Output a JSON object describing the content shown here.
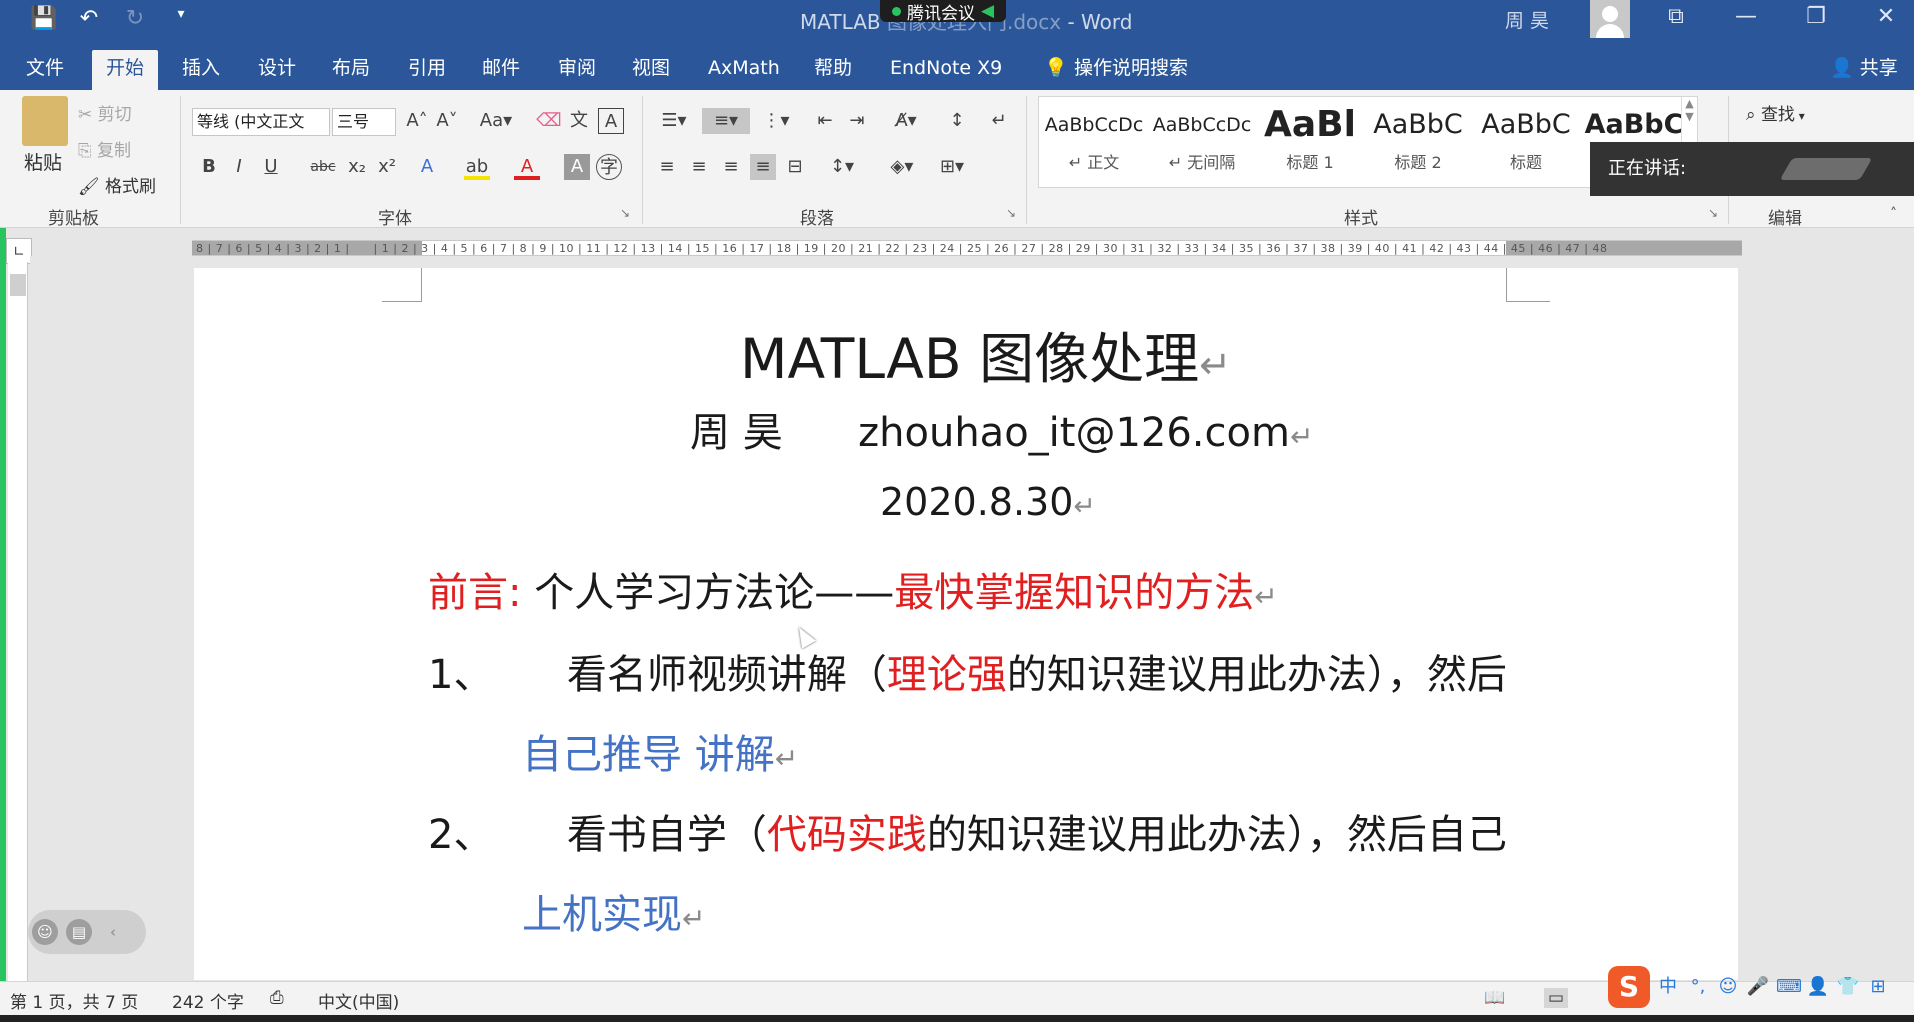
{
  "titlebar": {
    "title_prefix": "MATLAB",
    "title_file": "图像处理入门.docx",
    "title_app": "Word",
    "meeting_label": "腾讯会议",
    "user": "周 昊",
    "qat": {
      "save": "💾",
      "undo": "↶",
      "redo": "↻",
      "customize": "▾"
    },
    "win": {
      "ribbon_display": "⧉",
      "minimize": "—",
      "restore": "❐",
      "close": "✕"
    }
  },
  "tabs": [
    "文件",
    "开始",
    "插入",
    "设计",
    "布局",
    "引用",
    "邮件",
    "审阅",
    "视图",
    "AxMath",
    "帮助",
    "EndNote X9"
  ],
  "active_tab": "开始",
  "tell_me": "操作说明搜索",
  "share": "共享",
  "clipboard": {
    "paste": "粘贴",
    "cut": "剪切",
    "copy": "复制",
    "format_painter": "格式刷",
    "label": "剪贴板"
  },
  "font": {
    "name": "等线 (中文正文",
    "size": "三号",
    "label": "字体"
  },
  "paragraph": {
    "label": "段落"
  },
  "styles": {
    "label": "样式",
    "items": [
      {
        "sample": "AaBbCcDc",
        "name": "↵ 正文"
      },
      {
        "sample": "AaBbCcDc",
        "name": "↵ 无间隔"
      },
      {
        "sample": "AaBl",
        "name": "标题 1"
      },
      {
        "sample": "AaBbC",
        "name": "标题 2"
      },
      {
        "sample": "AaBbC",
        "name": "标题"
      },
      {
        "sample": "AaBbC",
        "name": ""
      }
    ]
  },
  "editing": {
    "find": "查找",
    "label": "编辑"
  },
  "speaking": {
    "label": "正在讲话:"
  },
  "document": {
    "title": "MATLAB 图像处理",
    "author": "周  昊",
    "email": "zhouhao_it@126.com",
    "date": "2020.8.30",
    "preface_label": "前言:",
    "preface_mid": "个人学习方法论——",
    "preface_red": "最快掌握知识的方法",
    "item1_num": "1、",
    "item1_a": "看名师视频讲解（",
    "item1_red": "理论强",
    "item1_b": "的知识建议用此办法），然后",
    "item1_blue": "自己推导    讲解",
    "item2_num": "2、",
    "item2_a": "看书自学（",
    "item2_red": "代码实践",
    "item2_b": "的知识建议用此办法），然后自己",
    "item2_blue": "上机实现",
    "para_mark": "↵"
  },
  "status": {
    "page": "第 1 页，共 7 页",
    "words": "242 个字",
    "lang": "中文(中国)"
  },
  "ime": {
    "logo": "S",
    "mode": "中"
  }
}
